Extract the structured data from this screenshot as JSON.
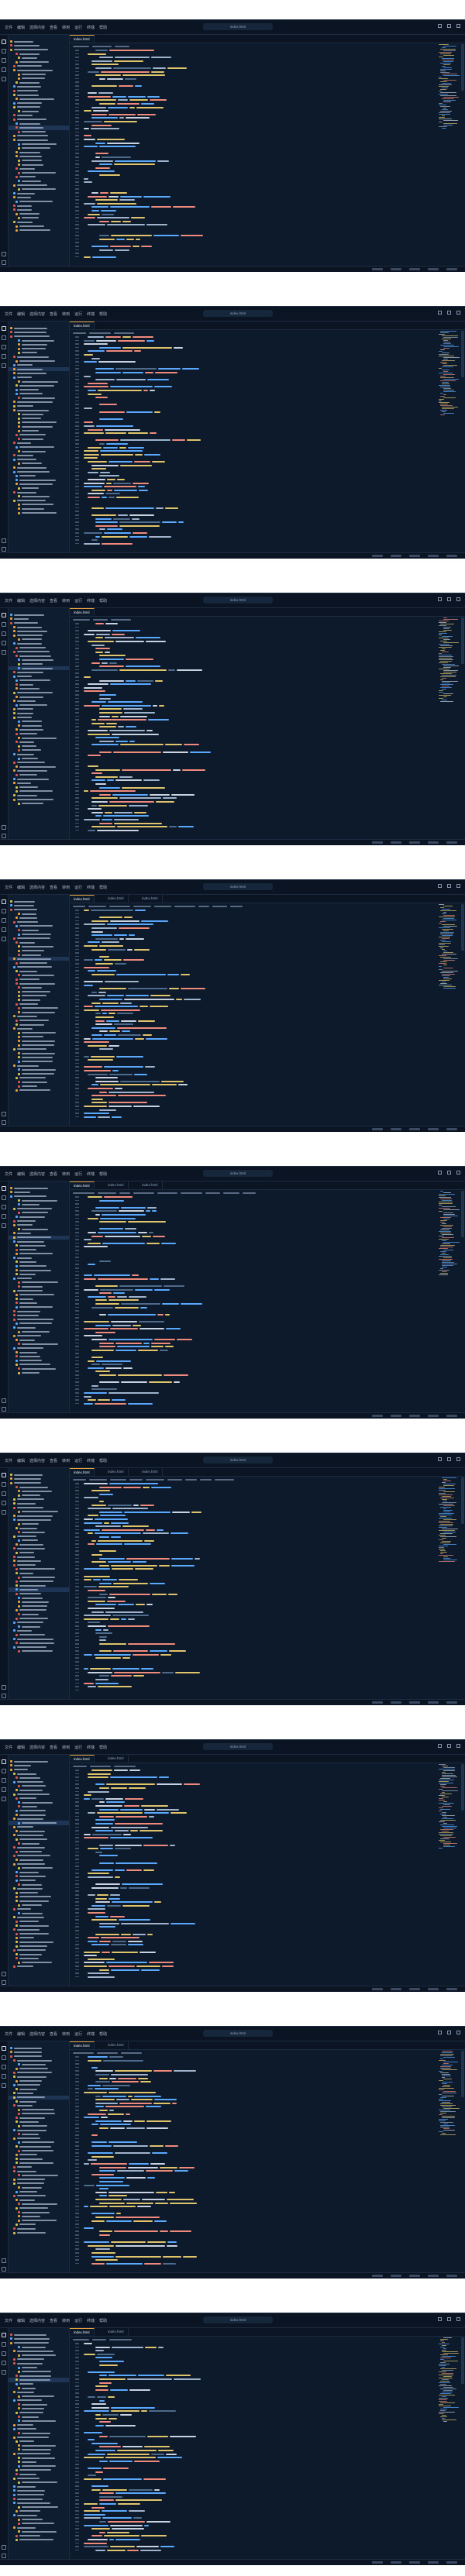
{
  "menu": [
    "文件",
    "编辑",
    "选择内容",
    "查看",
    "转到",
    "运行",
    "终端",
    "帮助"
  ],
  "screens": [
    {
      "title": "index.html",
      "tabs": [
        "index.html"
      ]
    },
    {
      "title": "index.html",
      "tabs": [
        "index.html"
      ]
    },
    {
      "title": "index.html",
      "tabs": [
        "index.html"
      ]
    },
    {
      "title": "index.html",
      "tabs": [
        "index.html",
        "index.html",
        "index.html"
      ]
    },
    {
      "title": "index.html",
      "tabs": [
        "index.html",
        "index.html",
        "index.html"
      ]
    },
    {
      "title": "index.html",
      "tabs": [
        "index.html",
        "index.html",
        "index.html"
      ]
    },
    {
      "title": "index.html",
      "tabs": [
        "index.html",
        "index.html"
      ]
    },
    {
      "title": "index.html",
      "tabs": [
        "index.html",
        "index.html"
      ]
    },
    {
      "title": "index.html",
      "tabs": [
        "index.html",
        "index.html"
      ]
    }
  ],
  "icons": {
    "explorer": "files-icon",
    "search": "search-icon",
    "git": "source-control-icon",
    "debug": "run-debug-icon",
    "extensions": "extensions-icon",
    "account": "account-icon",
    "settings": "gear-icon"
  },
  "colors": {
    "background": "#0d1a2b",
    "sidebar": "#0f1d30",
    "accent": "#e8a33d",
    "keyword": "#5aa9ff",
    "string": "#e0c46c",
    "tag": "#f08a7c",
    "comment": "#4f6b8c"
  }
}
